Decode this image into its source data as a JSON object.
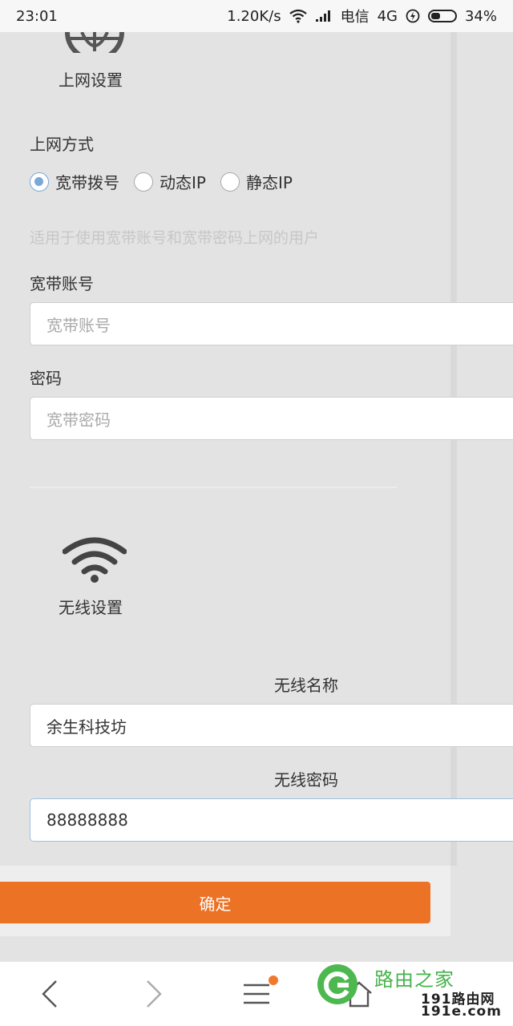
{
  "status_bar": {
    "time": "23:01",
    "speed": "1.20K/s",
    "carrier": "电信",
    "network": "4G",
    "battery": "34%"
  },
  "internet_section": {
    "title": "上网设置",
    "icon": "globe-icon",
    "mode_label": "上网方式",
    "modes": [
      {
        "label": "宽带拨号",
        "checked": true
      },
      {
        "label": "动态IP",
        "checked": false
      },
      {
        "label": "静态IP",
        "checked": false
      }
    ],
    "hint": "适用于使用宽带账号和宽带密码上网的用户",
    "account_label": "宽带账号",
    "account_placeholder": "宽带账号",
    "password_label": "密码",
    "password_placeholder": "宽带密码"
  },
  "wireless_section": {
    "title": "无线设置",
    "icon": "wifi-icon",
    "ssid_label": "无线名称",
    "ssid_value": "余生科技坊",
    "password_label": "无线密码",
    "password_value": "88888888"
  },
  "actions": {
    "confirm_label": "确定"
  },
  "watermark": {
    "title": "路由之家",
    "url_line1": "191路由网",
    "url_line2": "191e.com"
  },
  "colors": {
    "accent": "#ec7225",
    "radio": "#7aa8d8",
    "background": "#e3e3e3"
  }
}
